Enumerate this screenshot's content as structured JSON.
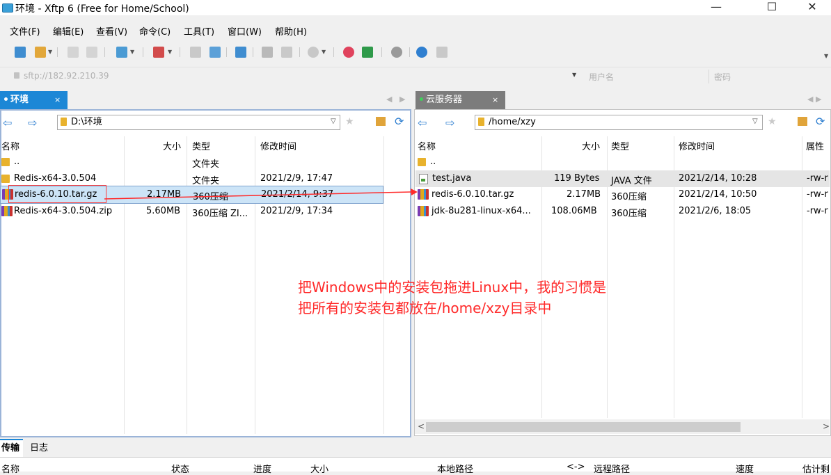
{
  "window": {
    "title": "环境 - Xftp 6 (Free for Home/School)",
    "min": "—",
    "max": "☐",
    "close": "✕"
  },
  "menu": [
    "文件(F)",
    "编辑(E)",
    "查看(V)",
    "命令(C)",
    "工具(T)",
    "窗口(W)",
    "帮助(H)"
  ],
  "address": {
    "url": "sftp://182.92.210.39",
    "username_placeholder": "用户名",
    "password_placeholder": "密码"
  },
  "left": {
    "tab_label": "环境",
    "tab_close": "×",
    "path": "D:\\环境",
    "columns": {
      "name": "名称",
      "size": "大小",
      "type": "类型",
      "modified": "修改时间"
    },
    "rows": [
      {
        "name": "..",
        "size": "",
        "type": "文件夹",
        "modified": ""
      },
      {
        "name": "Redis-x64-3.0.504",
        "size": "",
        "type": "文件夹",
        "modified": "2021/2/9, 17:47"
      },
      {
        "name": "redis-6.0.10.tar.gz",
        "size": "2.17MB",
        "type": "360压缩",
        "modified": "2021/2/14, 9:37"
      },
      {
        "name": "Redis-x64-3.0.504.zip",
        "size": "5.60MB",
        "type": "360压缩 ZI...",
        "modified": "2021/2/9, 17:34"
      }
    ]
  },
  "right": {
    "tab_label": "云服务器",
    "tab_close": "×",
    "path": "/home/xzy",
    "columns": {
      "name": "名称",
      "size": "大小",
      "type": "类型",
      "modified": "修改时间",
      "attr": "属性"
    },
    "rows": [
      {
        "name": "..",
        "size": "",
        "type": "",
        "modified": "",
        "attr": ""
      },
      {
        "name": "test.java",
        "size": "119 Bytes",
        "type": "JAVA 文件",
        "modified": "2021/2/14, 10:28",
        "attr": "-rw-r"
      },
      {
        "name": "redis-6.0.10.tar.gz",
        "size": "2.17MB",
        "type": "360压缩",
        "modified": "2021/2/14, 10:50",
        "attr": "-rw-r"
      },
      {
        "name": "jdk-8u281-linux-x64...",
        "size": "108.06MB",
        "type": "360压缩",
        "modified": "2021/2/6, 18:05",
        "attr": "-rw-r"
      }
    ]
  },
  "annotation": {
    "line1": "把Windows中的安装包拖进Linux中，我的习惯是",
    "line2": "把所有的安装包都放在/home/xzy目录中"
  },
  "bottom": {
    "tabs": [
      "传输",
      "日志"
    ],
    "columns": [
      "名称",
      "状态",
      "进度",
      "大小",
      "本地路径",
      "<->",
      "远程路径",
      "速度",
      "估计剩"
    ]
  },
  "colors": {
    "tab_blue": "#1c87d6",
    "accent_red": "#ff2a2a",
    "selection": "#cce4f7"
  }
}
